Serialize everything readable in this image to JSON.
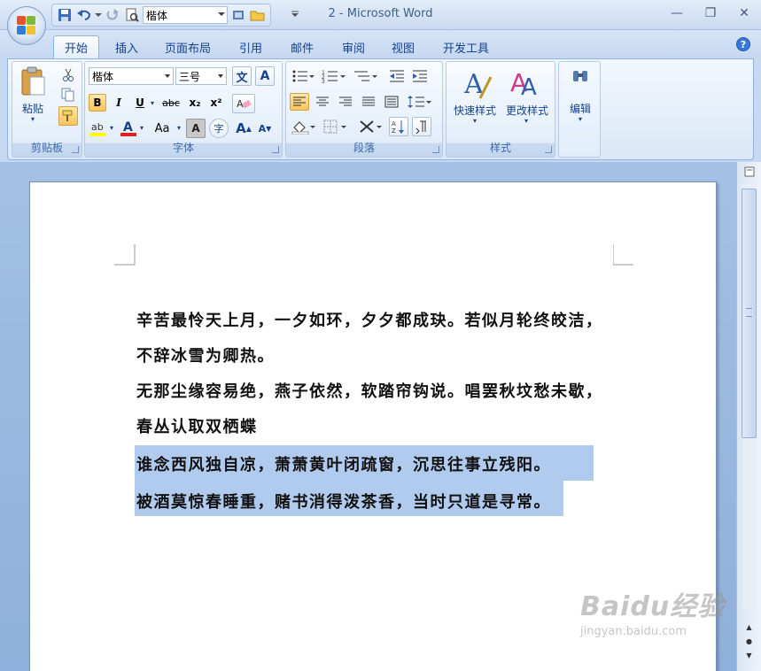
{
  "window": {
    "title": "2 - Microsoft Word",
    "minimize": "—",
    "restore": "❐",
    "close": "✕"
  },
  "qat": {
    "font_value": "楷体"
  },
  "tabs": [
    {
      "label": "开始"
    },
    {
      "label": "插入"
    },
    {
      "label": "页面布局"
    },
    {
      "label": "引用"
    },
    {
      "label": "邮件"
    },
    {
      "label": "审阅"
    },
    {
      "label": "视图"
    },
    {
      "label": "开发工具"
    }
  ],
  "ribbon": {
    "clipboard": {
      "label": "剪贴板",
      "paste": "粘贴"
    },
    "font": {
      "label": "字体",
      "font_name": "楷体",
      "font_size": "三号",
      "bold": "B",
      "italic": "I",
      "underline": "U",
      "strike": "abc",
      "subscript": "x₂",
      "superscript": "x²",
      "change_case": "Aa",
      "char_shading": "A",
      "grow": "A",
      "shrink": "A",
      "phonetic": "文",
      "border": "A",
      "enclose": "字"
    },
    "paragraph": {
      "label": "段落"
    },
    "styles": {
      "label": "样式",
      "quick_styles": "快速样式",
      "change_styles": "更改样式"
    },
    "editing": {
      "label": "编辑"
    }
  },
  "document": {
    "lines": [
      "辛苦最怜天上月，一夕如环，夕夕都成玦。若似月轮终皎洁，",
      "不辞冰雪为卿热。",
      "无那尘缘容易绝，燕子依然，软踏帘钩说。唱罢秋坟愁未歇，",
      "春丛认取双栖蝶",
      "谁念西风独自凉，萧萧黄叶闭疏窗，沉思往事立残阳。",
      "被酒莫惊春睡重，赌书消得泼茶香，当时只道是寻常。"
    ]
  },
  "watermark": {
    "brand": "Baidu经验",
    "url": "jingyan.baidu.com"
  },
  "colors": {
    "highlight": "#b1cbef",
    "ribbon_bg": "#dbe7f6",
    "font_color_bar": "#e02020",
    "highlighter_bar": "#ffff00"
  }
}
